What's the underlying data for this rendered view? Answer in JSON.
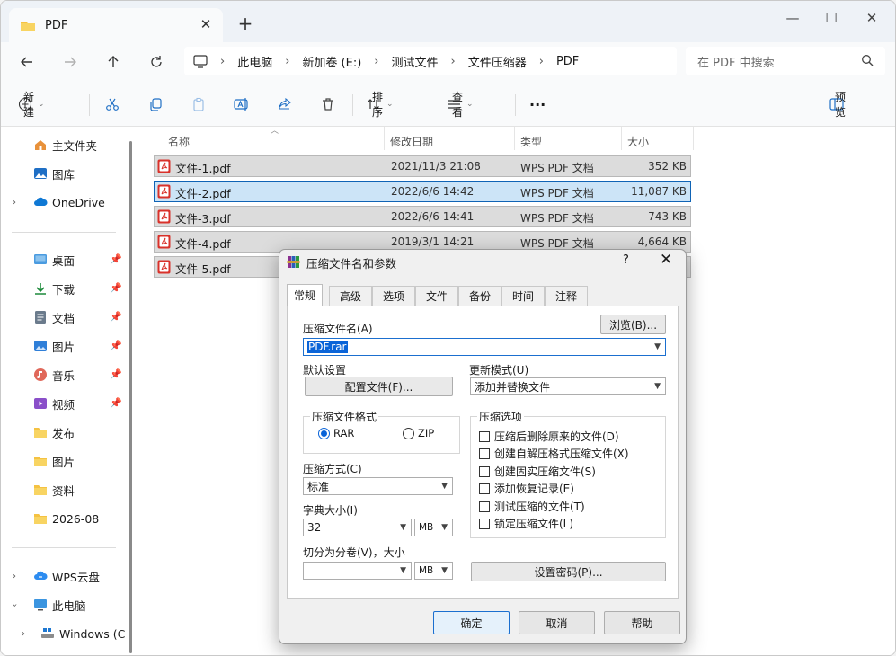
{
  "window": {
    "tab_title": "PDF",
    "tab_close": "✕",
    "new_tab": "+",
    "controls": {
      "minimize": "—",
      "maximize": "☐",
      "close": "✕"
    }
  },
  "address": {
    "crumbs": [
      "此电脑",
      "新加卷 (E:)",
      "测试文件",
      "文件压缩器",
      "PDF"
    ],
    "separator": "›"
  },
  "search": {
    "placeholder": "在 PDF 中搜索"
  },
  "commands": {
    "new_label": "新建",
    "sort_label": "排序",
    "view_label": "查看",
    "more": "···",
    "preview_label": "预览"
  },
  "sidebar": {
    "items": [
      {
        "label": "主文件夹",
        "icon": "home-icon"
      },
      {
        "label": "图库",
        "icon": "gallery-icon"
      },
      {
        "label": "OneDrive",
        "icon": "cloud-icon"
      },
      {
        "label": "桌面",
        "icon": "desktop-icon"
      },
      {
        "label": "下载",
        "icon": "download-icon"
      },
      {
        "label": "文档",
        "icon": "documents-icon"
      },
      {
        "label": "图片",
        "icon": "pictures-icon"
      },
      {
        "label": "音乐",
        "icon": "music-icon"
      },
      {
        "label": "视频",
        "icon": "video-icon"
      },
      {
        "label": "发布",
        "icon": "folder-icon"
      },
      {
        "label": "图片",
        "icon": "folder-icon"
      },
      {
        "label": "资料",
        "icon": "folder-icon"
      },
      {
        "label": "2026-08",
        "icon": "folder-icon"
      },
      {
        "label": "WPS云盘",
        "icon": "wps-cloud-icon"
      },
      {
        "label": "此电脑",
        "icon": "this-pc-icon"
      },
      {
        "label": "Windows (C",
        "icon": "drive-icon"
      }
    ]
  },
  "columns": {
    "name": "名称",
    "date": "修改日期",
    "type": "类型",
    "size": "大小"
  },
  "files": [
    {
      "name": "文件-1.pdf",
      "date": "2021/11/3 21:08",
      "type": "WPS PDF 文档",
      "size": "352 KB"
    },
    {
      "name": "文件-2.pdf",
      "date": "2022/6/6 14:42",
      "type": "WPS PDF 文档",
      "size": "11,087 KB"
    },
    {
      "name": "文件-3.pdf",
      "date": "2022/6/6 14:41",
      "type": "WPS PDF 文档",
      "size": "743 KB"
    },
    {
      "name": "文件-4.pdf",
      "date": "2019/3/1 14:21",
      "type": "WPS PDF 文档",
      "size": "4,664 KB"
    },
    {
      "name": "文件-5.pdf",
      "date": "",
      "type": "",
      "size": ""
    }
  ],
  "dialog": {
    "title": "压缩文件名和参数",
    "help": "?",
    "close": "✕",
    "tabs": [
      "常规",
      "高级",
      "选项",
      "文件",
      "备份",
      "时间",
      "注释"
    ],
    "archive_name_label": "压缩文件名(A)",
    "browse_button": "浏览(B)...",
    "archive_name_value": "PDF.rar",
    "default_settings_label": "默认设置",
    "profiles_button": "配置文件(F)...",
    "update_mode_label": "更新模式(U)",
    "update_mode_value": "添加并替换文件",
    "format_group": "压缩文件格式",
    "format_rar": "RAR",
    "format_zip": "ZIP",
    "method_label": "压缩方式(C)",
    "method_value": "标准",
    "dict_label": "字典大小(I)",
    "dict_value": "32",
    "dict_unit": "MB",
    "split_label": "切分为分卷(V)，大小",
    "split_value": "",
    "split_unit": "MB",
    "options_group": "压缩选项",
    "options": [
      "压缩后删除原来的文件(D)",
      "创建自解压格式压缩文件(X)",
      "创建固实压缩文件(S)",
      "添加恢复记录(E)",
      "测试压缩的文件(T)",
      "锁定压缩文件(L)"
    ],
    "password_button": "设置密码(P)...",
    "ok": "确定",
    "cancel": "取消",
    "help_button": "帮助"
  }
}
